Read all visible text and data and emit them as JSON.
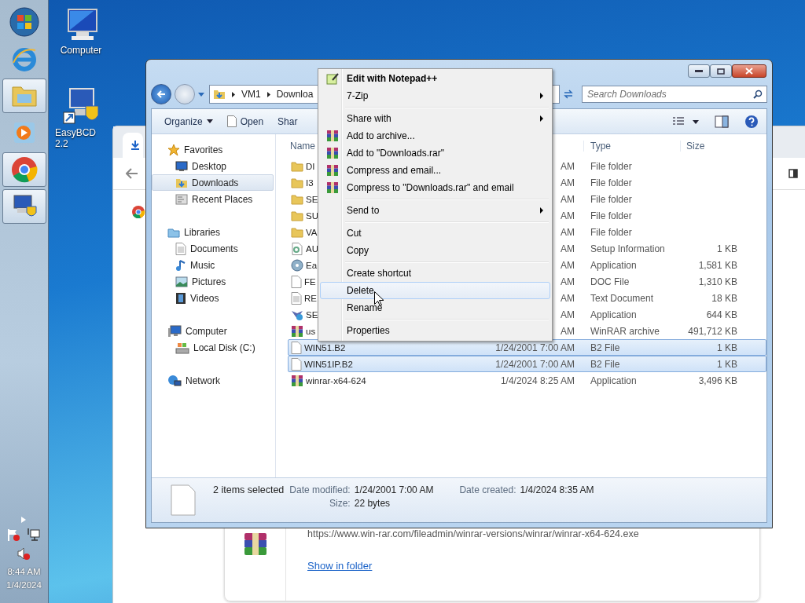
{
  "taskbar": {
    "buttons": [
      {
        "kind": "start",
        "active": false
      },
      {
        "kind": "browser",
        "active": false
      },
      {
        "kind": "explorer",
        "active": true
      },
      {
        "kind": "media",
        "active": false
      },
      {
        "kind": "chrome",
        "active": true
      },
      {
        "kind": "easybcd",
        "active": true
      }
    ],
    "tray": {
      "time": "8:44 AM",
      "date": "1/4/2024"
    }
  },
  "desktop_icons": [
    {
      "label": "Computer",
      "kind": "computer"
    },
    {
      "label": "EasyBCD 2.2",
      "kind": "easybcd"
    }
  ],
  "browser_window": {
    "download": {
      "url": "https://www.win-rar.com/fileadmin/winrar-versions/winrar/winrar-x64-624.exe",
      "link": "Show in folder"
    }
  },
  "explorer": {
    "address": {
      "crumbs": [
        "VM1",
        "Downloa"
      ]
    },
    "search": {
      "placeholder": "Search Downloads"
    },
    "toolbar": [
      {
        "label": "Organize",
        "kind": "menu"
      },
      {
        "label": "Open",
        "kind": "open"
      },
      {
        "label": "Shar",
        "kind": "plain"
      }
    ],
    "nav": [
      {
        "label": "Favorites",
        "kind": "star",
        "selected": false,
        "children": [
          {
            "label": "Desktop",
            "kind": "desktop",
            "selected": false
          },
          {
            "label": "Downloads",
            "kind": "downloads",
            "selected": true
          },
          {
            "label": "Recent Places",
            "kind": "recent",
            "selected": false
          }
        ]
      },
      {
        "label": "Libraries",
        "kind": "libraries",
        "selected": false,
        "children": [
          {
            "label": "Documents",
            "kind": "documents",
            "selected": false
          },
          {
            "label": "Music",
            "kind": "music",
            "selected": false
          },
          {
            "label": "Pictures",
            "kind": "pictures",
            "selected": false
          },
          {
            "label": "Videos",
            "kind": "videos",
            "selected": false
          }
        ]
      },
      {
        "label": "Computer",
        "kind": "computer",
        "selected": false,
        "children": [
          {
            "label": "Local Disk (C:)",
            "kind": "disk",
            "selected": false
          }
        ]
      },
      {
        "label": "Network",
        "kind": "network",
        "selected": false
      }
    ],
    "columns": [
      "Name",
      "Type",
      "Size"
    ],
    "rows": [
      {
        "name": "DI",
        "date": "AM",
        "type": "File folder",
        "kind": "folder",
        "selected": false
      },
      {
        "name": "I3",
        "date": "AM",
        "type": "File folder",
        "kind": "folder",
        "selected": false
      },
      {
        "name": "SE",
        "date": "AM",
        "type": "File folder",
        "kind": "folder",
        "selected": false
      },
      {
        "name": "SU",
        "date": "AM",
        "type": "File folder",
        "kind": "folder",
        "selected": false
      },
      {
        "name": "VA",
        "date": "AM",
        "type": "File folder",
        "kind": "folder",
        "selected": false
      },
      {
        "name": "AU",
        "date": "AM",
        "type": "Setup Information",
        "size": "1 KB",
        "kind": "settings",
        "selected": false
      },
      {
        "name": "Ea",
        "date": "AM",
        "type": "Application",
        "size": "1,581 KB",
        "kind": "disc",
        "selected": false
      },
      {
        "name": "FE",
        "date": "AM",
        "type": "DOC File",
        "size": "1,310 KB",
        "kind": "file",
        "selected": false
      },
      {
        "name": "RE",
        "date": "AM",
        "type": "Text Document",
        "size": "18 KB",
        "kind": "text",
        "selected": false
      },
      {
        "name": "SE",
        "date": "AM",
        "type": "Application",
        "size": "644 KB",
        "kind": "setup",
        "selected": false
      },
      {
        "name": "us",
        "date": "AM",
        "type": "WinRAR archive",
        "size": "491,712 KB",
        "kind": "archive",
        "selected": false
      },
      {
        "name": "WIN51.B2",
        "date": "1/24/2001 7:00 AM",
        "type": "B2 File",
        "size": "1 KB",
        "kind": "file",
        "selected": true
      },
      {
        "name": "WIN51IP.B2",
        "date": "1/24/2001 7:00 AM",
        "type": "B2 File",
        "size": "1 KB",
        "kind": "file",
        "selected": true
      },
      {
        "name": "winrar-x64-624",
        "date": "1/4/2024 8:25 AM",
        "type": "Application",
        "size": "3,496 KB",
        "kind": "archive",
        "selected": false
      }
    ],
    "details": {
      "summary": "2 items selected",
      "fields": [
        {
          "label": "Date modified:",
          "value": "1/24/2001 7:00 AM"
        },
        {
          "label": "Date created:",
          "value": "1/4/2024 8:35 AM"
        },
        {
          "label": "Size:",
          "value": "22 bytes"
        }
      ]
    }
  },
  "context_menu": {
    "groups": [
      [
        {
          "label": "Edit with Notepad++",
          "kind": "default",
          "selected": false
        },
        {
          "label": "7-Zip",
          "kind": "submenu",
          "selected": false
        }
      ],
      [
        {
          "label": "Share with",
          "kind": "submenu",
          "selected": false
        },
        {
          "label": "Add to archive...",
          "kind": "archive",
          "selected": false
        },
        {
          "label": "Add to \"Downloads.rar\"",
          "kind": "archive",
          "selected": false
        },
        {
          "label": "Compress and email...",
          "kind": "archive",
          "selected": false
        },
        {
          "label": "Compress to \"Downloads.rar\" and email",
          "kind": "archive",
          "selected": false
        }
      ],
      [
        {
          "label": "Send to",
          "kind": "submenu",
          "selected": false
        }
      ],
      [
        {
          "label": "Cut",
          "kind": "command",
          "selected": false
        },
        {
          "label": "Copy",
          "kind": "command",
          "selected": false
        }
      ],
      [
        {
          "label": "Create shortcut",
          "kind": "command",
          "selected": false
        },
        {
          "label": "Delete",
          "kind": "command",
          "selected": true
        },
        {
          "label": "Rename",
          "kind": "command",
          "selected": false
        }
      ],
      [
        {
          "label": "Properties",
          "kind": "command",
          "selected": false
        }
      ]
    ]
  }
}
